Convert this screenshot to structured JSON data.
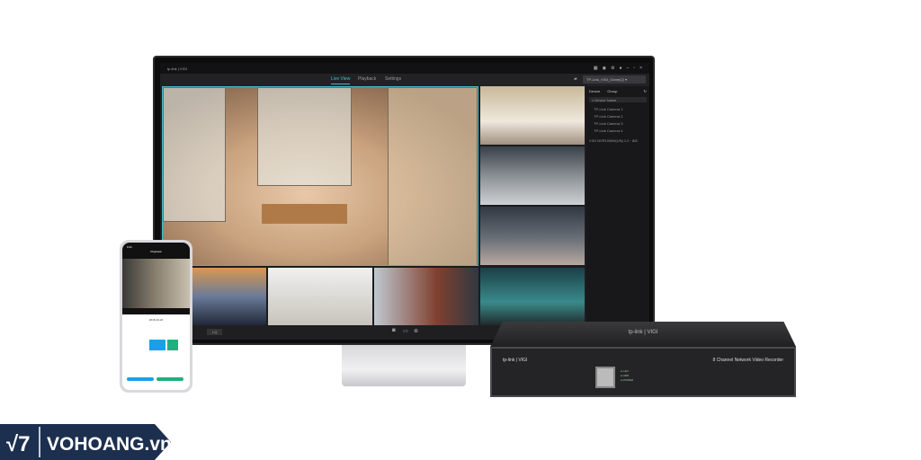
{
  "app": {
    "brand": "tp-link | VIGI"
  },
  "tabs": [
    {
      "label": "Live View",
      "active": true
    },
    {
      "label": "Playback"
    },
    {
      "label": "Settings"
    }
  ],
  "nvr_selector": "TP-Link_VIGI_Game(2)",
  "sidebar": {
    "tab_device": "Device",
    "tab_group": "Group",
    "search_placeholder": "Device Name",
    "cameras": [
      "TP-Link Camera 1",
      "TP-Link Camera 2",
      "TP-Link Camera 3",
      "TP-Link Camera 4"
    ],
    "nvr": "VIGI NVR1008H(UN) 1.0 · 8/8"
  },
  "toolbar": {
    "stream": "LQ"
  },
  "phone": {
    "title": "Playback",
    "date": "2018-10-22",
    "time": "9:41"
  },
  "nvr_device": {
    "brand": "tp-link | VIGI",
    "label": "8 Channel Network Video Recorder",
    "leds": [
      "LAN",
      "HDD",
      "POWER"
    ]
  },
  "watermark": {
    "text": "VOHOANG.vn"
  },
  "colors": {
    "accent": "#3fc0c8",
    "logo_bg": "#1d2f4f"
  }
}
